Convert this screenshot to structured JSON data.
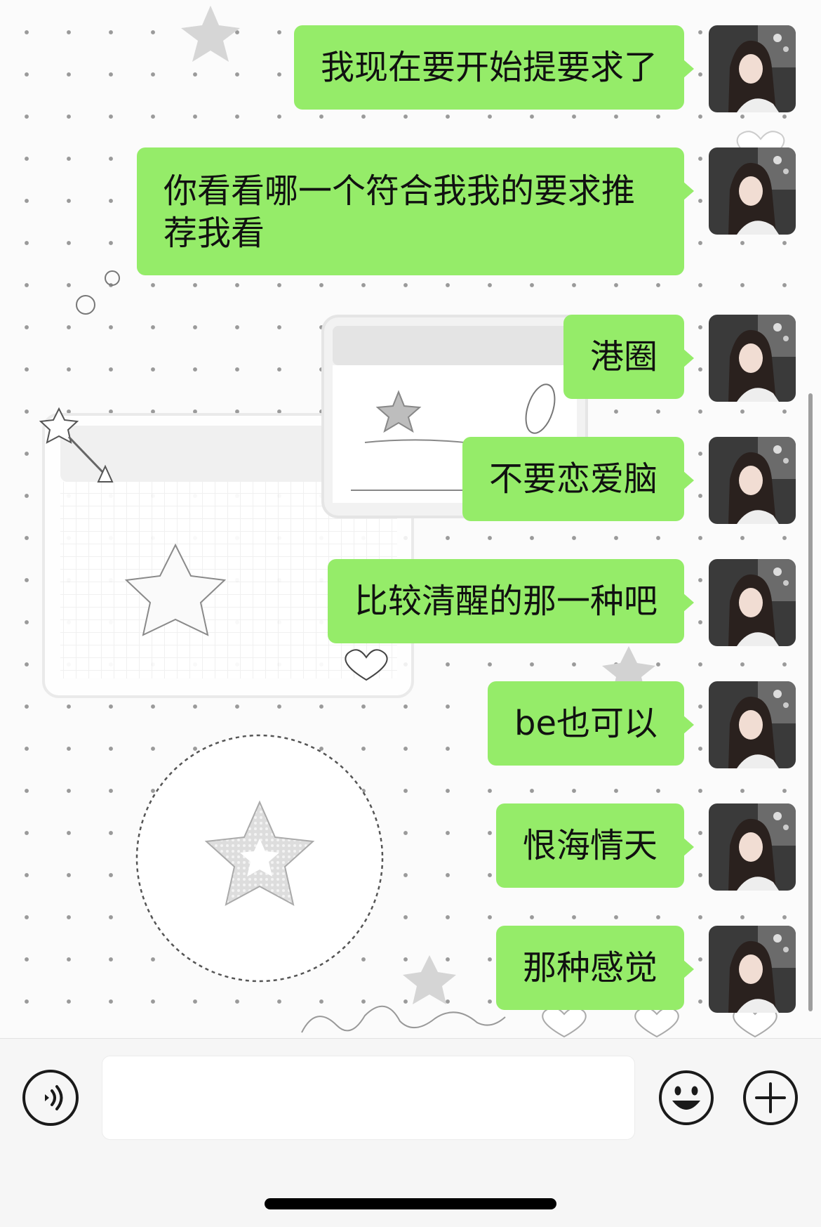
{
  "chat": {
    "messages": [
      {
        "text": "我现在要开始提要求了"
      },
      {
        "text": "你看看哪一个符合我我的要求推荐我看"
      },
      {
        "text": "港圈"
      },
      {
        "text": "不要恋爱脑"
      },
      {
        "text": "比较清醒的那一种吧"
      },
      {
        "text": "be也可以"
      },
      {
        "text": "恨海情天"
      },
      {
        "text": "那种感觉"
      }
    ]
  },
  "input_bar": {
    "voice_icon": "voice-icon",
    "emoji_icon": "smiley-icon",
    "more_icon": "plus-icon",
    "input_value": ""
  },
  "colors": {
    "bubble_green": "#95ec69",
    "input_bar_bg": "#f6f6f6",
    "text": "#111111"
  }
}
